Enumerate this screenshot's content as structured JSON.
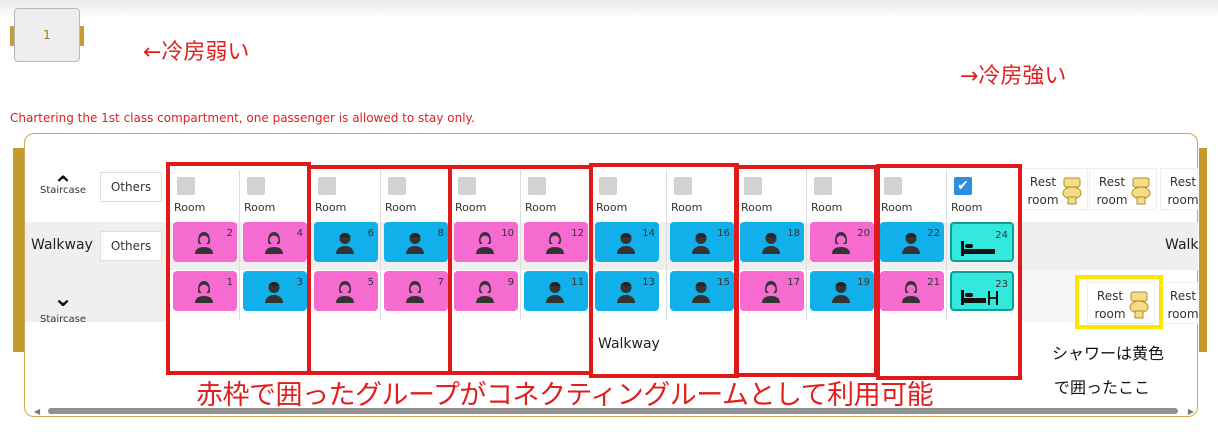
{
  "car": {
    "number": "1"
  },
  "notes": {
    "weak_ac": "←冷房弱い",
    "strong_ac": "→冷房強い",
    "notice": "Chartering the 1st class compartment, one passenger is allowed to stay only.",
    "connecting": "赤枠で囲ったグループがコネクティングルームとして利用可能",
    "shower_line1": "シャワーは黄色",
    "shower_line2": "で囲ったここ"
  },
  "labels": {
    "staircase": "Staircase",
    "walkway": "Walkway",
    "walkway_cut": "Walk",
    "others": "Others",
    "room": "Room",
    "rest_line1": "Rest",
    "rest_line2": "room"
  },
  "rooms": [
    {
      "checked": false
    },
    {
      "checked": false
    },
    {
      "checked": false
    },
    {
      "checked": false
    },
    {
      "checked": false
    },
    {
      "checked": false
    },
    {
      "checked": false
    },
    {
      "checked": false
    },
    {
      "checked": false
    },
    {
      "checked": false
    },
    {
      "checked": false
    },
    {
      "checked": true
    }
  ],
  "seats_top": [
    {
      "num": "2",
      "type": "female"
    },
    {
      "num": "4",
      "type": "female"
    },
    {
      "num": "6",
      "type": "male"
    },
    {
      "num": "8",
      "type": "male"
    },
    {
      "num": "10",
      "type": "female"
    },
    {
      "num": "12",
      "type": "female"
    },
    {
      "num": "14",
      "type": "male"
    },
    {
      "num": "16",
      "type": "male"
    },
    {
      "num": "18",
      "type": "male"
    },
    {
      "num": "20",
      "type": "female"
    },
    {
      "num": "22",
      "type": "male"
    },
    {
      "num": "24",
      "type": "bed"
    }
  ],
  "seats_bottom": [
    {
      "num": "1",
      "type": "female"
    },
    {
      "num": "3",
      "type": "male"
    },
    {
      "num": "5",
      "type": "female"
    },
    {
      "num": "7",
      "type": "female"
    },
    {
      "num": "9",
      "type": "female"
    },
    {
      "num": "11",
      "type": "male"
    },
    {
      "num": "13",
      "type": "male"
    },
    {
      "num": "15",
      "type": "male"
    },
    {
      "num": "17",
      "type": "female"
    },
    {
      "num": "19",
      "type": "male"
    },
    {
      "num": "21",
      "type": "female"
    },
    {
      "num": "23",
      "type": "bed-shower"
    }
  ],
  "colors": {
    "female_seat": "#f56bcf",
    "male_seat": "#12b0ea",
    "bed_seat": "#33e8dc",
    "annotation_red": "#e01a1a",
    "annotation_yellow": "#ffe400",
    "checkbox_selected": "#2d8ee0"
  }
}
